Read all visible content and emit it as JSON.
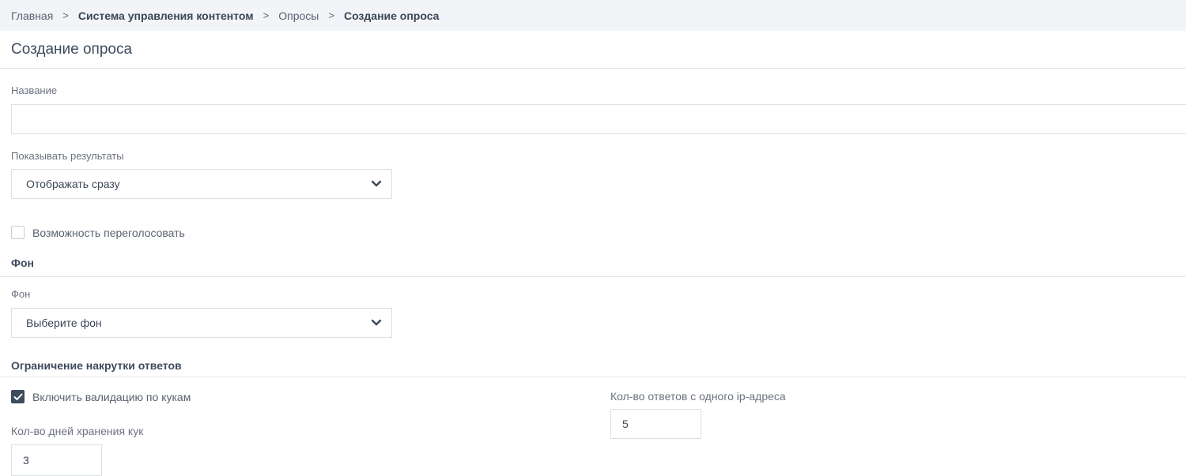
{
  "breadcrumb": {
    "items": [
      "Главная",
      "Система управления контентом",
      "Опросы",
      "Создание опроса"
    ],
    "separator": ">"
  },
  "page": {
    "title": "Создание опроса"
  },
  "form": {
    "name": {
      "label": "Название",
      "value": ""
    },
    "show_results": {
      "label": "Показывать результаты",
      "selected": "Отображать сразу"
    },
    "revote": {
      "label": "Возможность переголосовать",
      "checked": false
    },
    "background_section": {
      "title": "Фон",
      "label": "Фон",
      "selected": "Выберите фон"
    },
    "limit_section": {
      "title": "Ограничение накрутки ответов",
      "cookie_validation": {
        "label": "Включить валидацию по кукам",
        "checked": true
      },
      "cookie_days": {
        "label": "Кол-во дней хранения кук",
        "value": "3"
      },
      "ip_answers": {
        "label": "Кол-во ответов с одного ip-адреса",
        "value": "5"
      }
    }
  },
  "icons": {
    "chevron": "chevron-down-icon",
    "check": "checkmark-icon"
  },
  "colors": {
    "breadcrumb_bg": "#f2f4f7",
    "title_text": "#3d4b5e",
    "checkbox_checked": "#3d4b5e",
    "border": "#dcdfe4"
  }
}
